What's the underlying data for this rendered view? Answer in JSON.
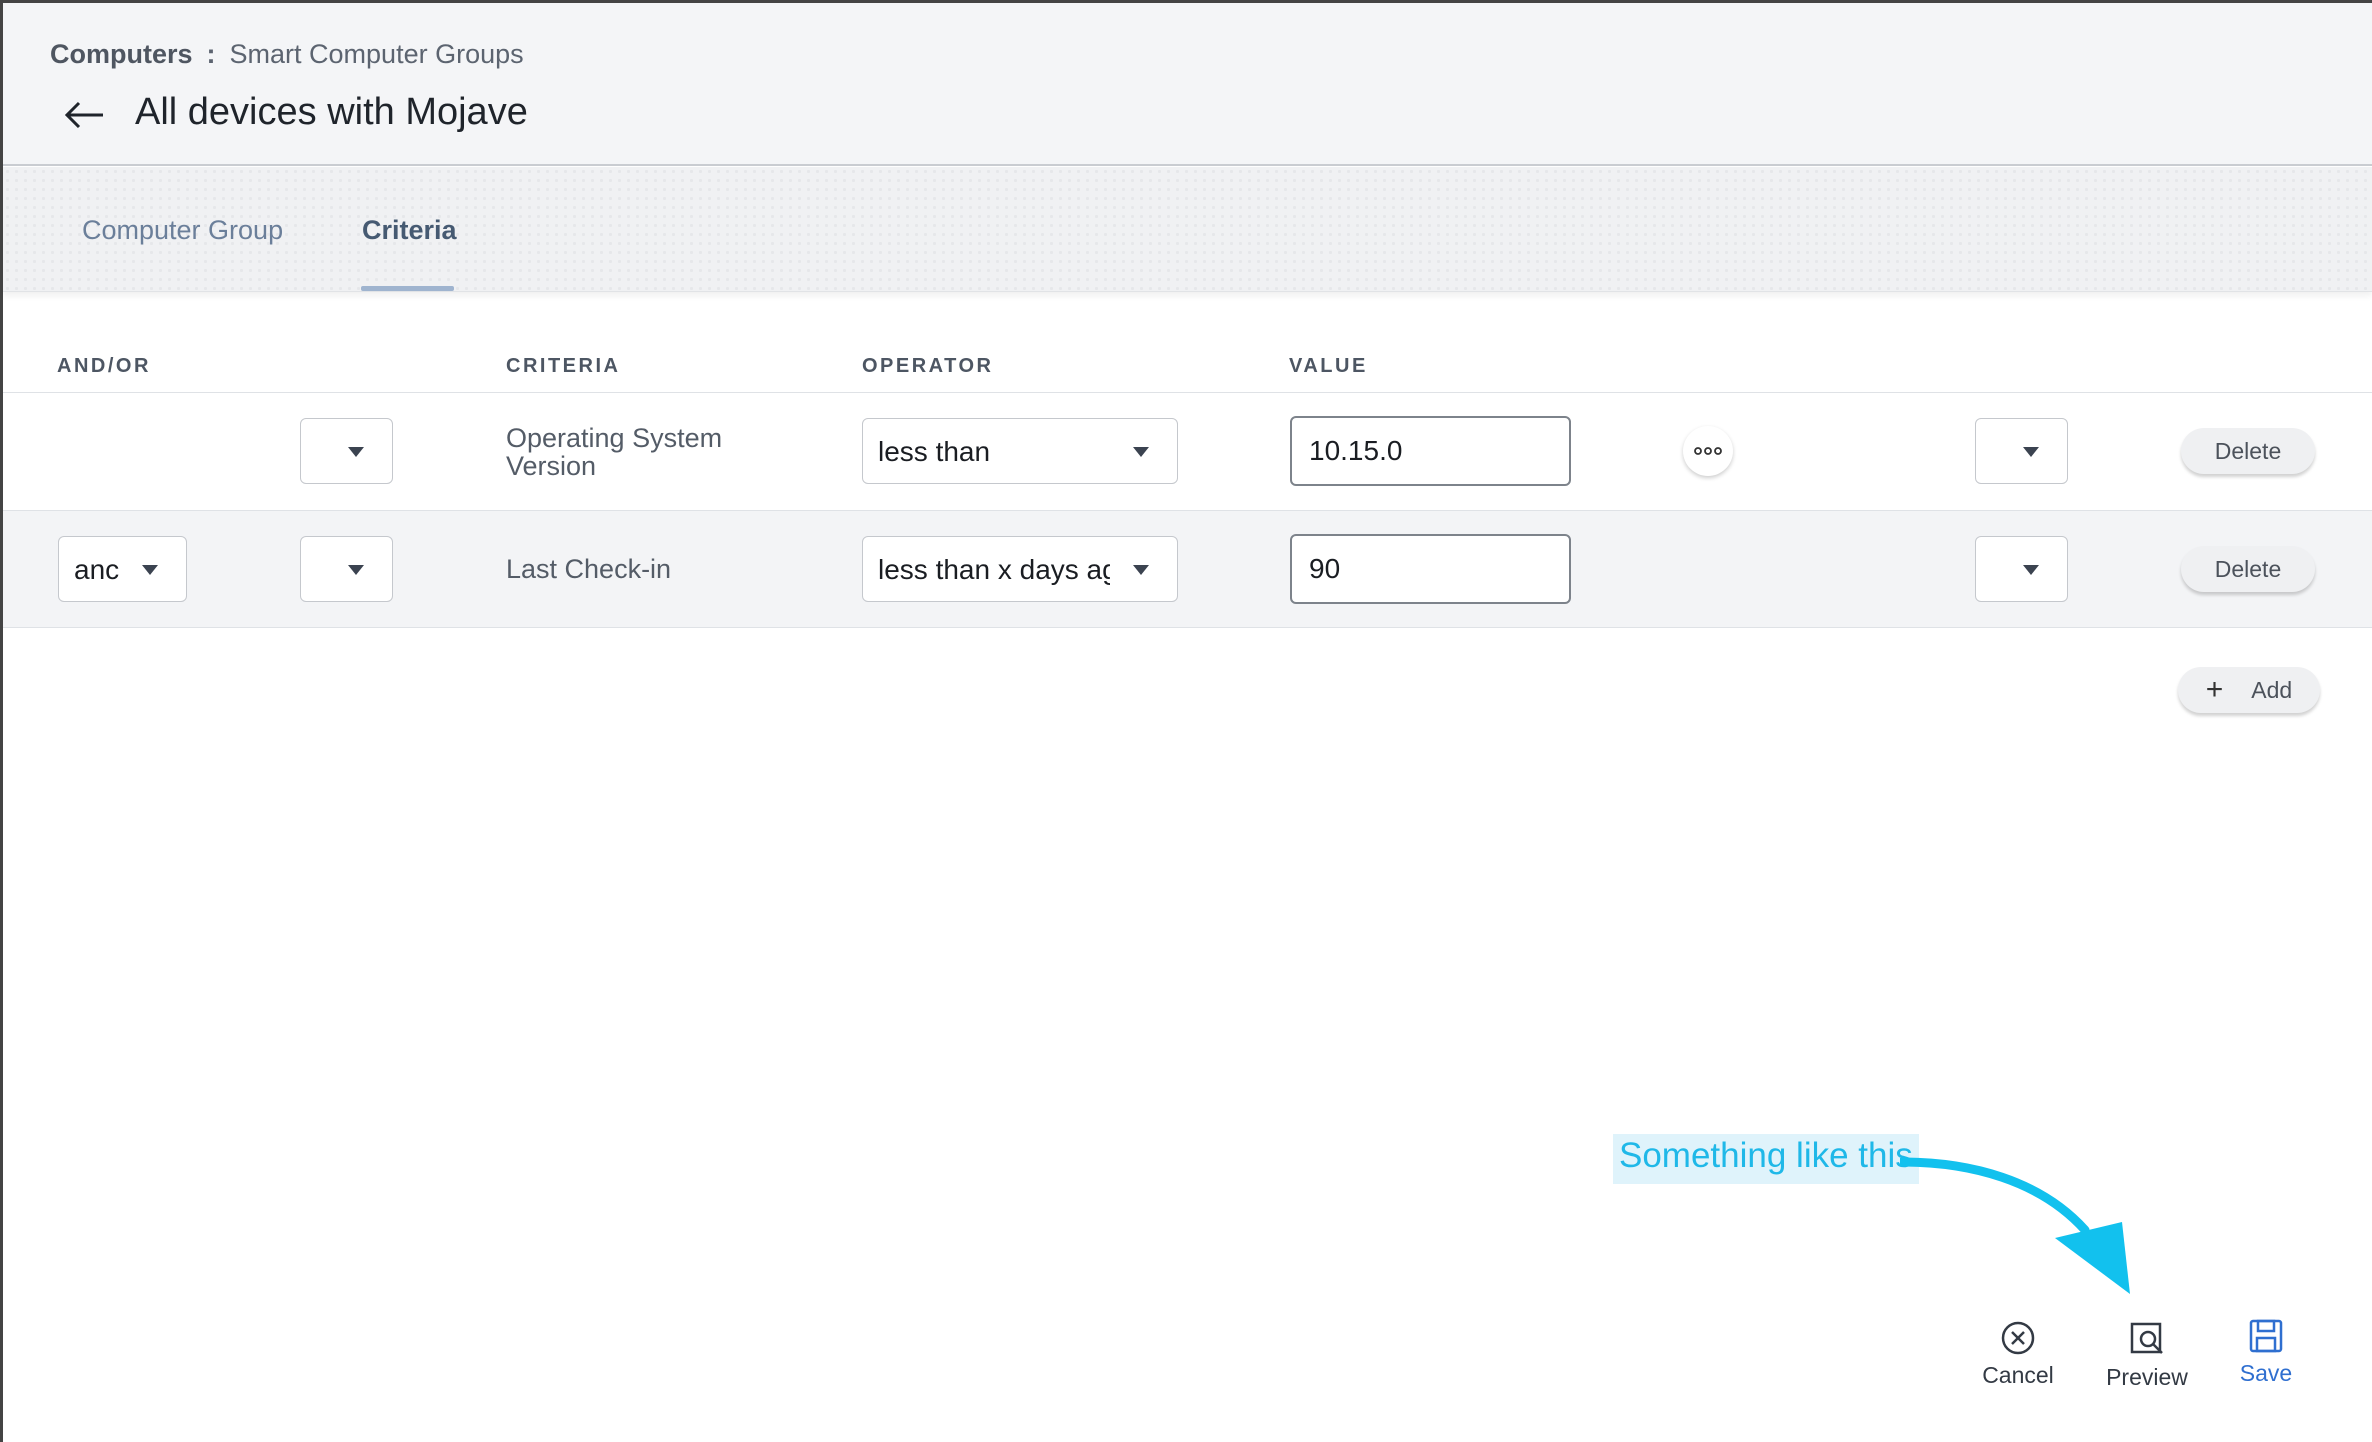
{
  "header": {
    "breadcrumb_root": "Computers",
    "breadcrumb_separator": ":",
    "breadcrumb_current": "Smart Computer Groups",
    "title": "All devices with Mojave"
  },
  "tabs": [
    {
      "label": "Computer Group",
      "active": false
    },
    {
      "label": "Criteria",
      "active": true
    }
  ],
  "table": {
    "columns": [
      "AND/OR",
      "CRITERIA",
      "OPERATOR",
      "VALUE"
    ],
    "rows": [
      {
        "and_or": "",
        "open_paren": "",
        "criteria": "Operating System Version",
        "operator": "less than",
        "value": "10.15.0",
        "close_paren": "",
        "delete_label": "Delete"
      },
      {
        "and_or": "anc",
        "open_paren": "",
        "criteria": "Last Check-in",
        "operator": "less than x days ag",
        "value": "90",
        "close_paren": "",
        "delete_label": "Delete"
      }
    ],
    "add_label": "Add"
  },
  "actions": {
    "cancel": "Cancel",
    "preview": "Preview",
    "save": "Save"
  },
  "annotation": {
    "text": "Something like this"
  },
  "colors": {
    "accent_save": "#2f6fd0",
    "annotation": "#1fb8e8",
    "tab_active": "#465a72"
  }
}
